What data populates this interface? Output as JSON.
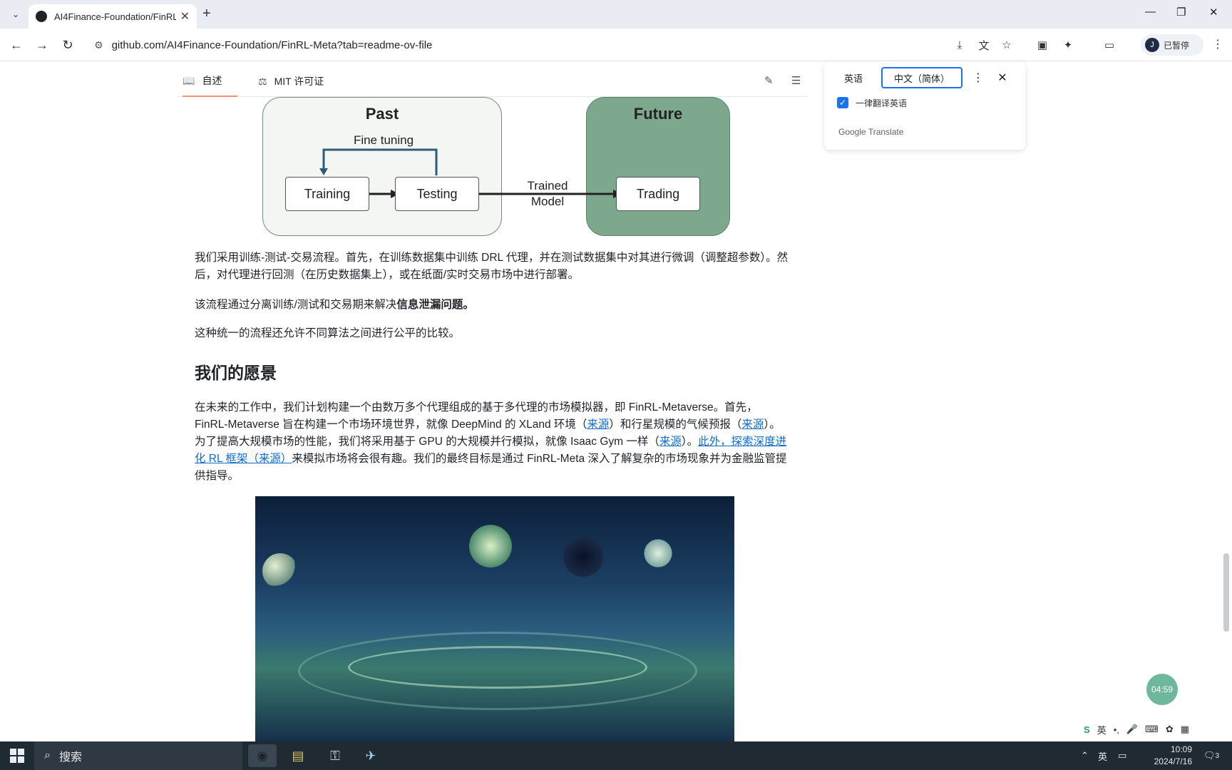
{
  "browser": {
    "tab_title": "AI4Finance-Foundation/FinRL",
    "url": "github.com/AI4Finance-Foundation/FinRL-Meta?tab=readme-ov-file",
    "profile_initial": "J",
    "profile_label": "已暂停"
  },
  "readme_nav": {
    "readme_tab": "自述",
    "license_tab": "MIT 许可证"
  },
  "diagram": {
    "past_title": "Past",
    "future_title": "Future",
    "fine_tuning": "Fine tuning",
    "training": "Training",
    "testing": "Testing",
    "trained_model": "Trained Model",
    "trading": "Trading"
  },
  "content": {
    "p1": "我们采用训练-测试-交易流程。首先，在训练数据集中训练 DRL 代理，并在测试数据集中对其进行微调（调整超参数）。然后，对代理进行回测（在历史数据集上），或在纸面/实时交易市场中进行部署。",
    "p2_prefix": "该流程通过分离训练/测试和交易期来解决",
    "p2_bold": "信息泄漏问题。",
    "p3": "这种统一的流程还允许不同算法之间进行公平的比较。",
    "h2": "我们的愿景",
    "p4_a": "在未来的工作中，我们计划构建一个由数万多个代理组成的基于多代理的市场模拟器，即 FinRL-Metaverse。首先，FinRL-Metaverse 旨在构建一个市场环境世界，就像 DeepMind 的 XLand 环境（",
    "p4_link1": "来源",
    "p4_b": "）和行星规模的气候预报（",
    "p4_link2": "来源",
    "p4_c": "）。为了提高大规模市场的性能，我们将采用基于 GPU 的大规模并行模拟，就像 Isaac Gym 一样（",
    "p4_link3": "来源",
    "p4_d": "）。",
    "p4_link4": "此外，探索深度进化 RL 框架（来源）",
    "p4_e": "来模拟市场将会很有趣。我们的最终目标是通过 FinRL-Meta 深入了解复杂的市场现象并为金融监管提供指导。"
  },
  "translate": {
    "lang_source": "英语",
    "lang_target": "中文（简体）",
    "always_translate": "一律翻译英语",
    "brand": "Google Translate"
  },
  "timer": "04:59",
  "taskbar": {
    "search": "搜索",
    "ime": "英",
    "tray_ime": "英",
    "time": "10:09",
    "date": "2024/7/16",
    "notif_count": "3"
  }
}
